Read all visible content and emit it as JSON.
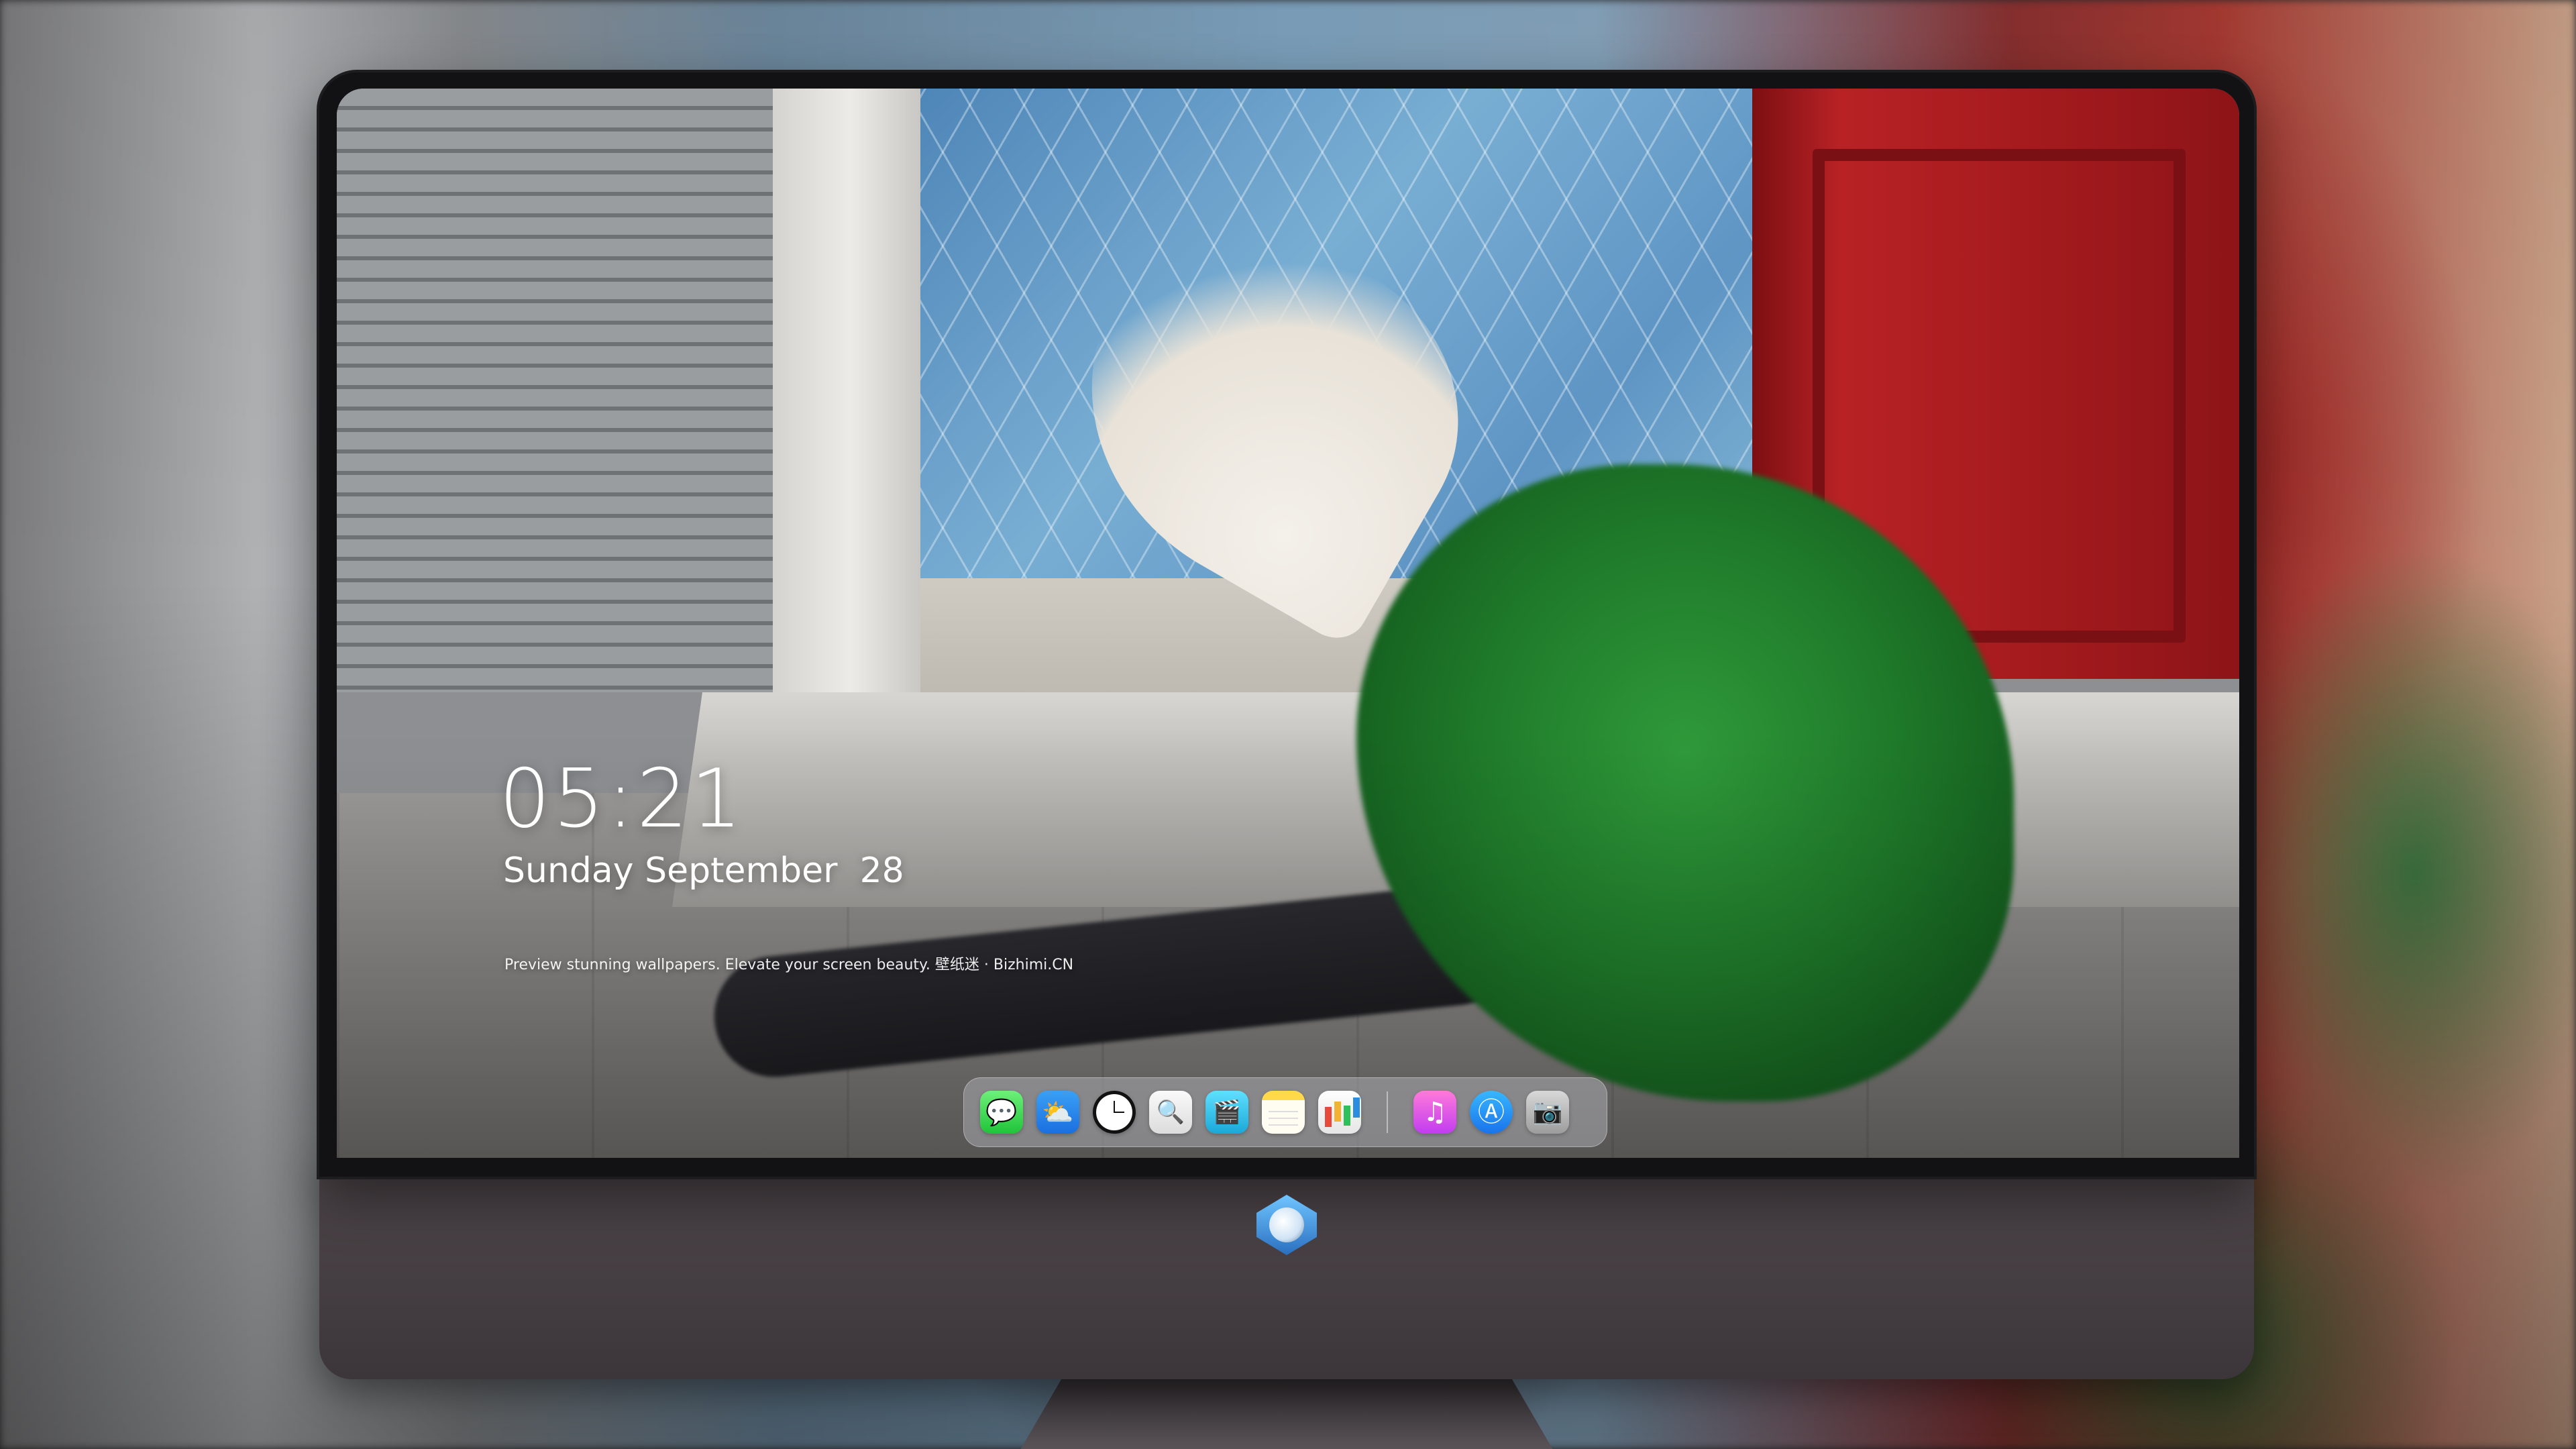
{
  "lock_screen": {
    "time": "05:21",
    "date": "Sunday September  28",
    "tagline": "Preview stunning wallpapers. Elevate your screen beauty. 壁纸迷 · Bizhimi.CN"
  },
  "dock": {
    "apps_left": [
      {
        "name": "Messages",
        "icon": "speech-bubble-icon"
      },
      {
        "name": "Weather",
        "icon": "cloud-sun-icon"
      },
      {
        "name": "Clock",
        "icon": "clock-icon"
      },
      {
        "name": "Preview",
        "icon": "preview-icon"
      },
      {
        "name": "Clips",
        "icon": "clapperboard-icon"
      },
      {
        "name": "Notes",
        "icon": "notes-icon"
      },
      {
        "name": "Numbers",
        "icon": "bar-chart-icon"
      }
    ],
    "apps_right": [
      {
        "name": "Music",
        "icon": "music-note-icon"
      },
      {
        "name": "App Store",
        "icon": "app-store-icon"
      },
      {
        "name": "Camera",
        "icon": "camera-icon"
      }
    ]
  },
  "colors": {
    "monitor_chin": "#443d41",
    "bezel": "#121214",
    "dock_bg": "rgba(170,170,175,0.55)"
  },
  "chin_logo": {
    "icon": "shield-mascot-logo"
  }
}
